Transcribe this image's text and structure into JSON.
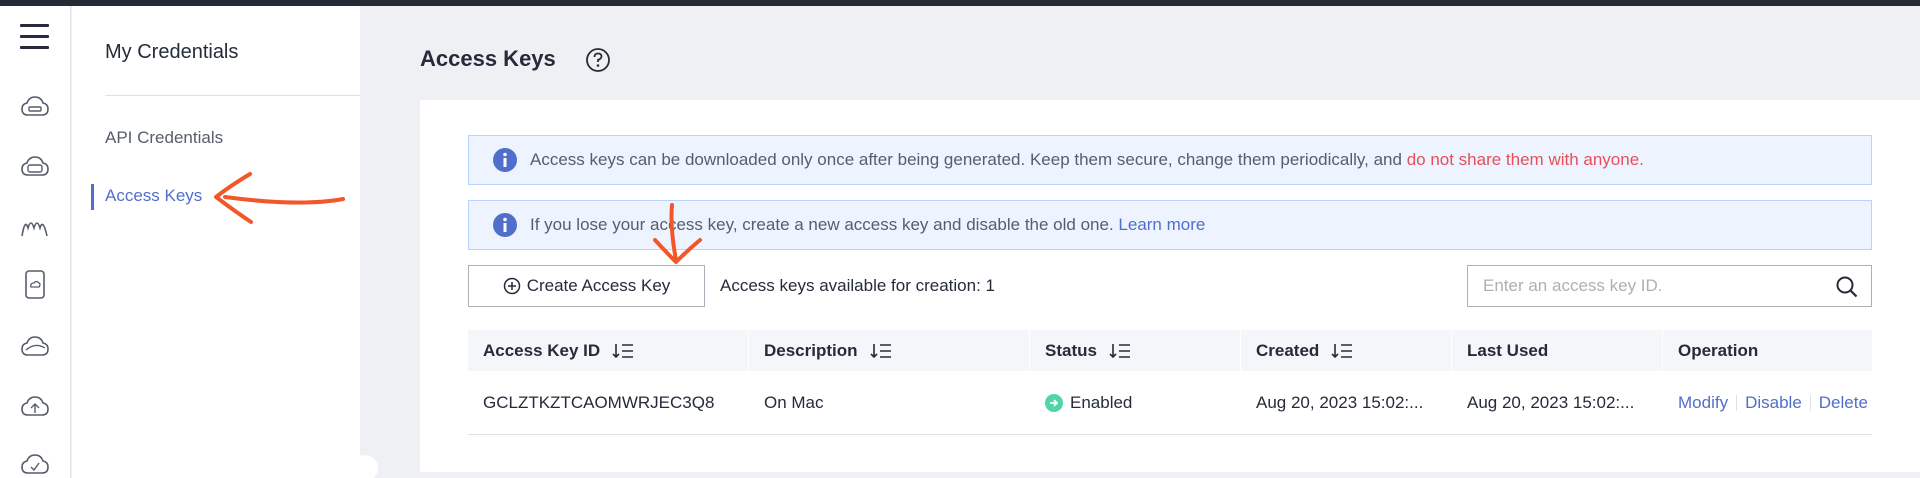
{
  "rail": {
    "icons": [
      "cloud-server-icon",
      "disk-icon",
      "network-wave-icon",
      "phone-cloud-icon",
      "cloud-icon",
      "cloud-upload-icon",
      "cloud-check-icon"
    ]
  },
  "sidebar": {
    "title": "My Credentials",
    "items": [
      {
        "label": "API Credentials",
        "active": false
      },
      {
        "label": "Access Keys",
        "active": true
      }
    ]
  },
  "page": {
    "title": "Access Keys"
  },
  "alerts": {
    "first": {
      "text": "Access keys can be downloaded only once after being generated. Keep them secure, change them periodically, and ",
      "warning": "do not share them with anyone."
    },
    "second": {
      "text": "If you lose your access key, create a new access key and disable the old one. ",
      "link": "Learn more"
    }
  },
  "toolbar": {
    "create_label": "Create Access Key",
    "available_text": "Access keys available for creation: 1",
    "search_placeholder": "Enter an access key ID."
  },
  "table": {
    "columns": [
      "Access Key ID",
      "Description",
      "Status",
      "Created",
      "Last Used",
      "Operation"
    ],
    "rows": [
      {
        "id": "GCLZTKZTCAOMWRJEC3Q8",
        "description": "On Mac",
        "status": "Enabled",
        "created": "Aug 20, 2023 15:02:...",
        "last_used": "Aug 20, 2023 15:02:...",
        "operations": [
          "Modify",
          "Disable",
          "Delete"
        ]
      }
    ]
  },
  "colors": {
    "accent": "#526ecc",
    "warning": "#e84f5a",
    "enabled": "#50d4ab",
    "annotation": "#f2572a"
  }
}
